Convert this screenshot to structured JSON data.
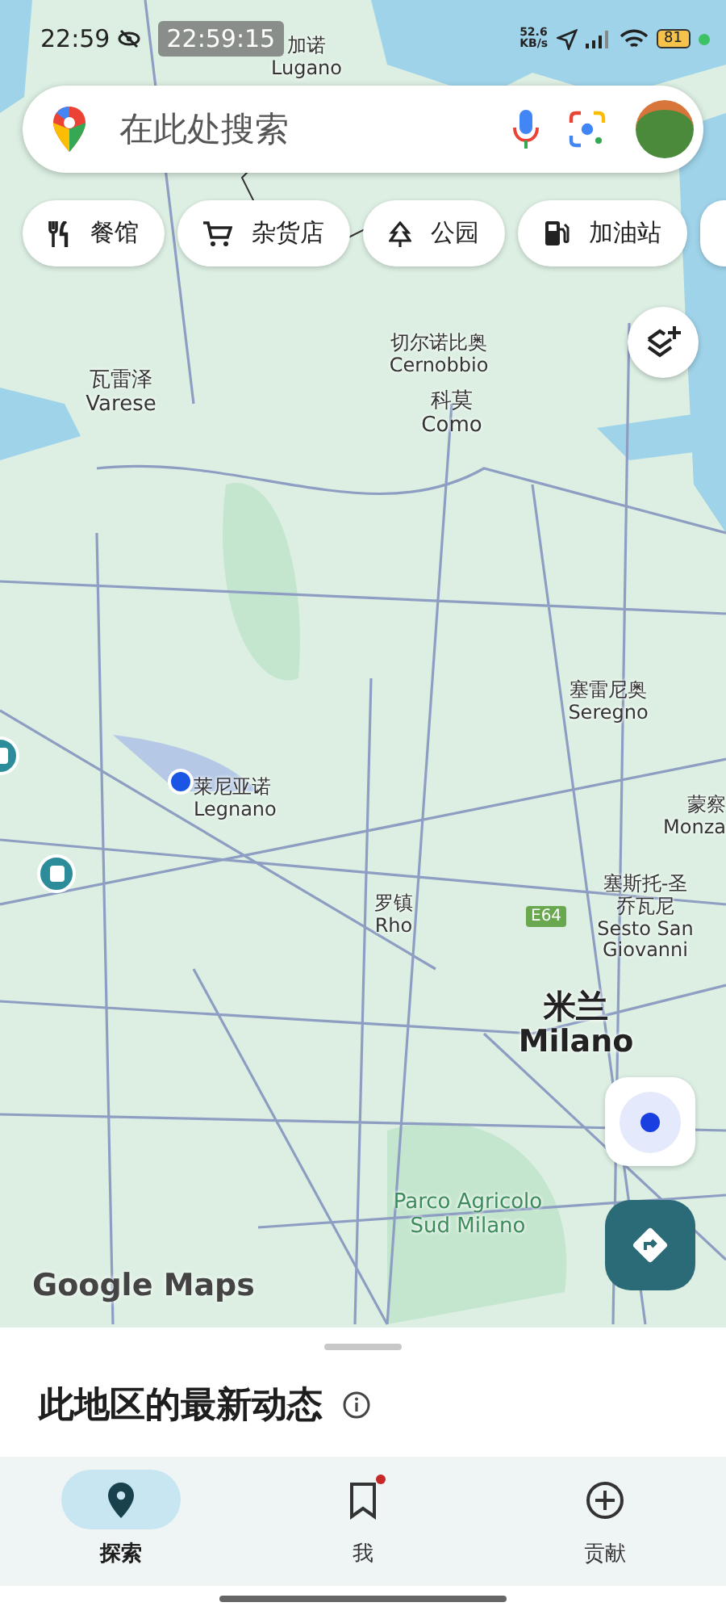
{
  "status_bar": {
    "time": "22:59",
    "overlay_clock": "22:59:15",
    "net_speed_value": "52.6",
    "net_speed_unit": "KB/s",
    "battery": "81"
  },
  "search": {
    "placeholder": "在此处搜索"
  },
  "chips": [
    {
      "label": "餐馆",
      "kind": "restaurant"
    },
    {
      "label": "杂货店",
      "kind": "grocery"
    },
    {
      "label": "公园",
      "kind": "park"
    },
    {
      "label": "加油站",
      "kind": "fuel"
    },
    {
      "kind": "more"
    }
  ],
  "map_labels": [
    {
      "zh": "加诺",
      "en": "Lugano",
      "kind": "town"
    },
    {
      "zh": "切尔诺比奥",
      "en": "Cernobbio",
      "kind": "town"
    },
    {
      "zh": "科莫",
      "en": "Como",
      "kind": "city"
    },
    {
      "zh": "瓦雷泽",
      "en": "Varese",
      "kind": "city"
    },
    {
      "zh": "塞雷尼奥",
      "en": "Seregno",
      "kind": "town"
    },
    {
      "zh": "莱尼亚诺",
      "en": "Legnano",
      "kind": "town"
    },
    {
      "zh": "蒙察",
      "en": "Monza",
      "kind": "town"
    },
    {
      "zh": "罗镇",
      "en": "Rho",
      "kind": "town"
    },
    {
      "zh": "塞斯托-圣乔瓦尼",
      "en": "Sesto San Giovanni",
      "kind": "town"
    },
    {
      "zh": "米兰",
      "en": "Milano",
      "kind": "capital"
    },
    {
      "en": "Parco Agricolo Sud Milano",
      "kind": "park"
    }
  ],
  "road_shield": "E64",
  "logo": "Google Maps",
  "sheet": {
    "title": "此地区的最新动态"
  },
  "nav": [
    {
      "label": "探索",
      "kind": "explore",
      "selected": true,
      "badge": false
    },
    {
      "label": "我",
      "kind": "saved",
      "selected": false,
      "badge": true
    },
    {
      "label": "贡献",
      "kind": "contribute",
      "selected": false,
      "badge": false
    }
  ]
}
